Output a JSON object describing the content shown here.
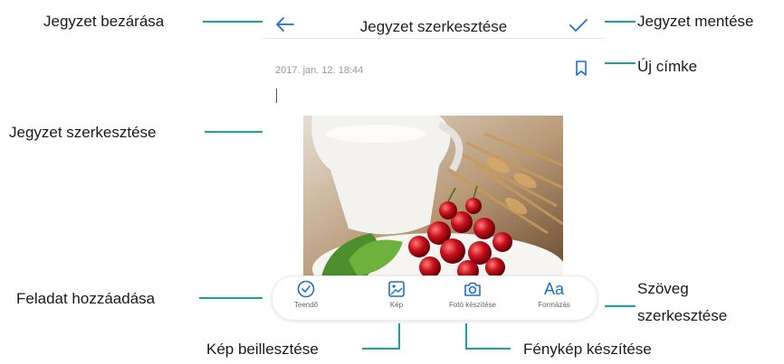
{
  "app": {
    "title": "Jegyzet szerkesztése",
    "datetime": "2017. jan. 12. 18:44",
    "icons": {
      "back": "back-arrow-icon",
      "save": "checkmark-icon",
      "tag": "bookmark-icon",
      "photo": "photo-image"
    }
  },
  "toolbar": {
    "items": [
      {
        "label": "Teendő",
        "icon": "checkbox-circle-icon"
      },
      {
        "label": "Kép",
        "icon": "image-icon"
      },
      {
        "label": "Fotó készítése",
        "icon": "camera-icon"
      },
      {
        "label": "Formázás",
        "icon": "text-format-icon",
        "glyph": "Aa"
      }
    ]
  },
  "annotations": {
    "close": "Jegyzet bezárása",
    "save": "Jegyzet mentése",
    "new_tag": "Új címke",
    "edit": "Jegyzet szerkesztése",
    "add_task": "Feladat hozzáadása",
    "text_edit_line1": "Szöveg",
    "text_edit_line2": "szerkesztése",
    "insert_image": "Kép beillesztése",
    "take_photo": "Fénykép készítése"
  },
  "colors": {
    "accent": "#1a6fd1",
    "annotation_line": "#1aa3a3"
  }
}
